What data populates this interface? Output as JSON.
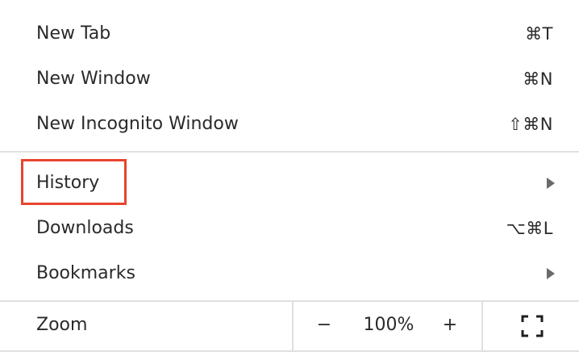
{
  "menu": {
    "items": [
      {
        "label": "New Tab",
        "shortcut": "⌘T"
      },
      {
        "label": "New Window",
        "shortcut": "⌘N"
      },
      {
        "label": "New Incognito Window",
        "shortcut": "⇧⌘N"
      },
      {
        "label": "History",
        "submenu": true
      },
      {
        "label": "Downloads",
        "shortcut": "⌥⌘L"
      },
      {
        "label": "Bookmarks",
        "submenu": true
      }
    ],
    "zoom": {
      "label": "Zoom",
      "minus": "−",
      "value": "100%",
      "plus": "+"
    }
  },
  "colors": {
    "highlight": "#e8442e",
    "divider": "#e0e0e0",
    "text": "#2a2a2a"
  },
  "icons": {
    "submenu": "chevron-right-icon",
    "fullscreen": "fullscreen-icon"
  }
}
